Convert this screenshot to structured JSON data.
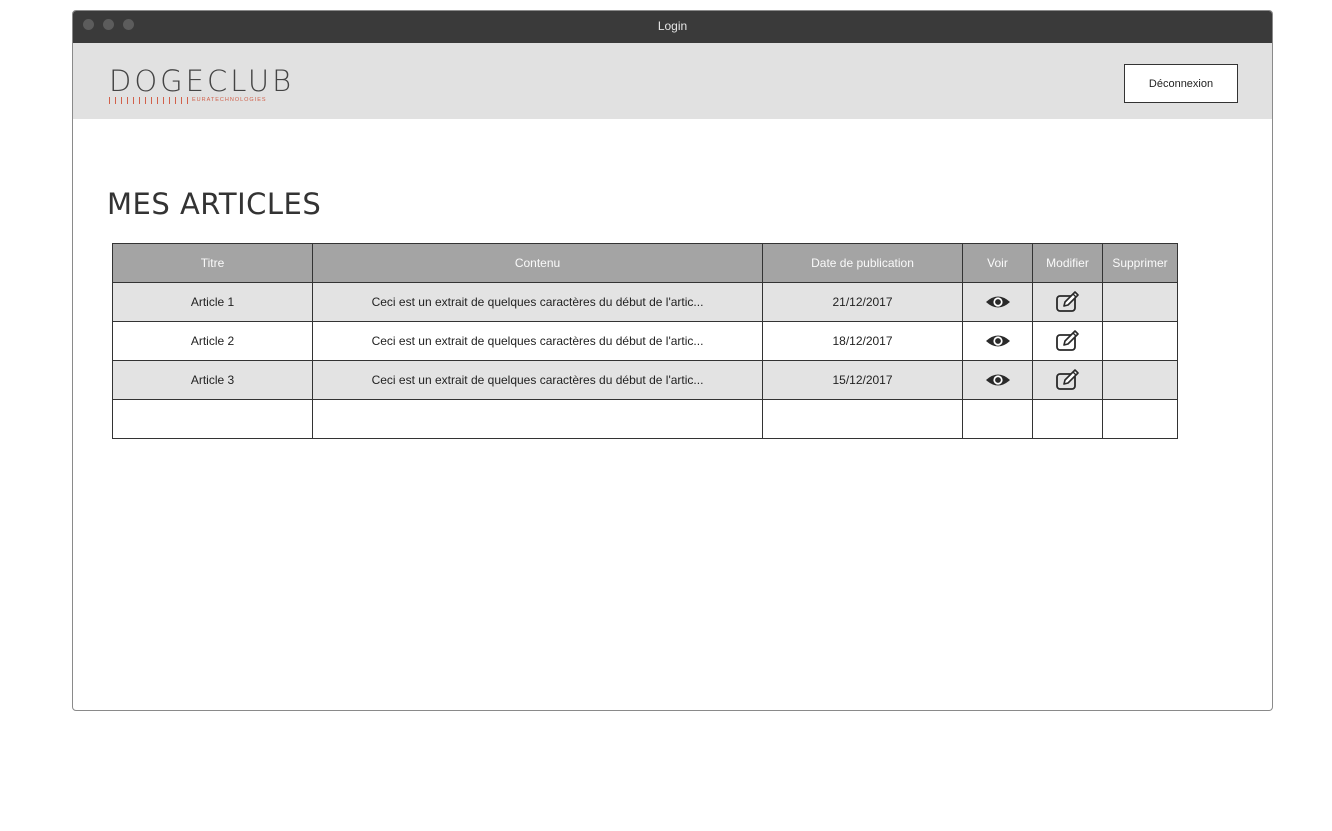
{
  "window": {
    "title": "Login"
  },
  "header": {
    "logo_text": "DOGECLUB",
    "logo_tagline": "EURATECHNOLOGIES",
    "logout_label": "Déconnexion"
  },
  "page": {
    "title": "MES ARTICLES"
  },
  "table": {
    "columns": [
      "Titre",
      "Contenu",
      "Date de publication",
      "Voir",
      "Modifier",
      "Supprimer"
    ],
    "rows": [
      {
        "title": "Article 1",
        "content": "Ceci est un extrait de quelques caractères du début de l'artic...",
        "date": "21/12/2017"
      },
      {
        "title": "Article 2",
        "content": "Ceci est un extrait de quelques caractères du début de l'artic...",
        "date": "18/12/2017"
      },
      {
        "title": "Article 3",
        "content": "Ceci est un extrait de quelques caractères du début de l'artic...",
        "date": "15/12/2017"
      }
    ],
    "icons": {
      "view": "eye-icon",
      "edit": "edit-icon"
    }
  },
  "colors": {
    "titlebar": "#3a3a3a",
    "header": "#e1e1e1",
    "table_header": "#a4a4a4",
    "row_alt": "#e3e3e3",
    "logo_accent": "#d1604a"
  }
}
